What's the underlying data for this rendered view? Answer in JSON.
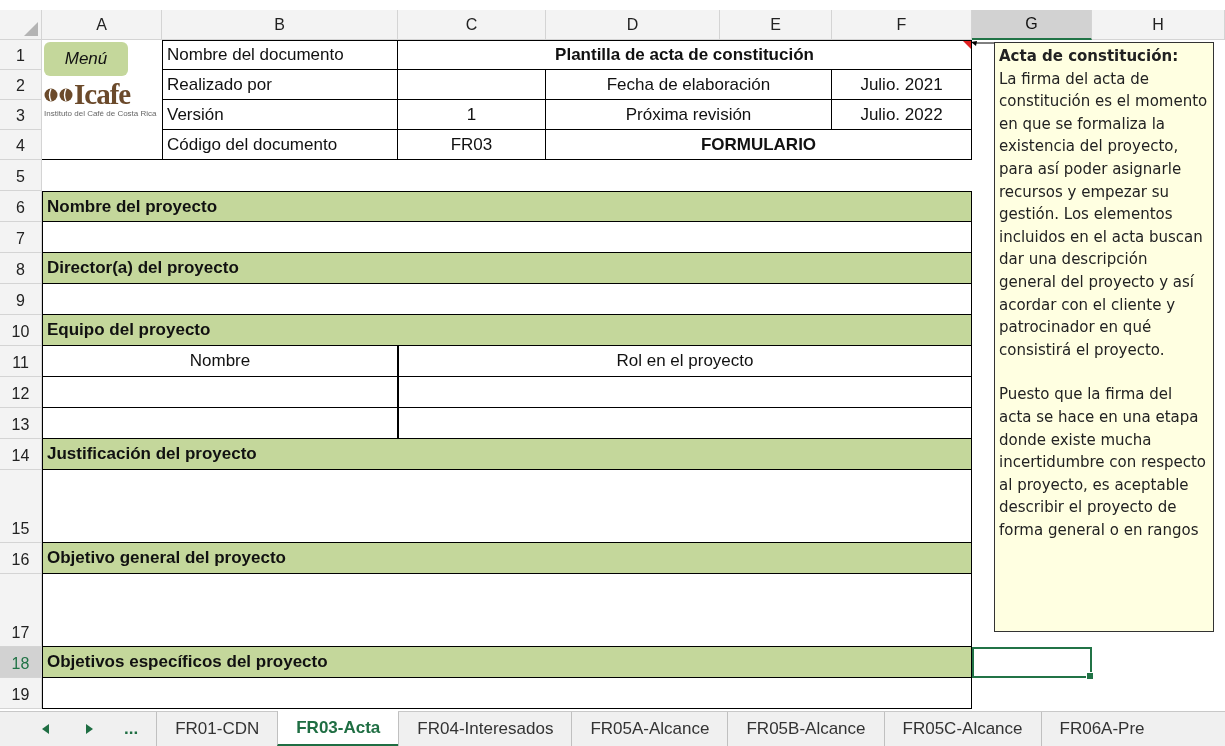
{
  "columns": [
    {
      "label": "A",
      "selected": false
    },
    {
      "label": "B",
      "selected": false
    },
    {
      "label": "C",
      "selected": false
    },
    {
      "label": "D",
      "selected": false
    },
    {
      "label": "E",
      "selected": false
    },
    {
      "label": "F",
      "selected": false
    },
    {
      "label": "G",
      "selected": true
    },
    {
      "label": "H",
      "selected": false
    }
  ],
  "row_numbers": [
    {
      "label": "1",
      "selected": false
    },
    {
      "label": "2",
      "selected": false
    },
    {
      "label": "3",
      "selected": false
    },
    {
      "label": "4",
      "selected": false
    },
    {
      "label": "5",
      "selected": false
    },
    {
      "label": "6",
      "selected": false
    },
    {
      "label": "7",
      "selected": false
    },
    {
      "label": "8",
      "selected": false
    },
    {
      "label": "9",
      "selected": false
    },
    {
      "label": "10",
      "selected": false
    },
    {
      "label": "11",
      "selected": false
    },
    {
      "label": "12",
      "selected": false
    },
    {
      "label": "13",
      "selected": false
    },
    {
      "label": "14",
      "selected": false
    },
    {
      "label": "15",
      "selected": false
    },
    {
      "label": "16",
      "selected": false
    },
    {
      "label": "17",
      "selected": false
    },
    {
      "label": "18",
      "selected": true
    },
    {
      "label": "19",
      "selected": false
    }
  ],
  "menu_button": "Menú",
  "logo": {
    "name": "Icafe",
    "subtitle": "Instituto del Café de Costa Rica"
  },
  "document_header": {
    "title_label": "Nombre del documento",
    "title": "Plantilla de acta de constitución",
    "author_label": "Realizado por",
    "date_label": "Fecha de elaboración",
    "date": "Julio. 2021",
    "version_label": "Versión",
    "version": "1",
    "revision_label": "Próxima revisión",
    "revision": "Julio. 2022",
    "code_label": "Código del documento",
    "code": "FR03",
    "form_type": "FORMULARIO"
  },
  "body_rows": [
    {
      "kind": "spacer"
    },
    {
      "kind": "heading",
      "text": "Nombre del proyecto"
    },
    {
      "kind": "blank"
    },
    {
      "kind": "heading",
      "text": "Director(a) del proyecto"
    },
    {
      "kind": "blank"
    },
    {
      "kind": "heading",
      "text": "Equipo del proyecto"
    },
    {
      "kind": "team-header",
      "cells": [
        "Nombre",
        "Rol en el proyecto"
      ]
    },
    {
      "kind": "team-row"
    },
    {
      "kind": "team-row"
    },
    {
      "kind": "heading",
      "text": "Justificación del proyecto"
    },
    {
      "kind": "blank-tall"
    },
    {
      "kind": "heading",
      "text": "Objetivo general del proyecto"
    },
    {
      "kind": "blank-tall"
    },
    {
      "kind": "heading",
      "text": "Objetivos específicos del proyecto"
    },
    {
      "kind": "blank"
    }
  ],
  "comment": {
    "title": "Acta de constitución:",
    "paragraphs": [
      "La firma del acta de constitución es el momento en que se formaliza la existencia del proyecto, para así poder asignarle recursos y empezar su gestión. Los elementos incluidos en el acta buscan dar una descripción general del proyecto y así acordar con el cliente y patrocinador en qué consistirá el proyecto.",
      "Puesto que la firma del acta se hace en una etapa donde existe mucha incertidumbre con respecto al proyecto, es aceptable describir el proyecto de forma general o en rangos"
    ]
  },
  "sheet_nav": {
    "more": "..."
  },
  "sheet_tabs": [
    {
      "label": "FR01-CDN",
      "selected": false
    },
    {
      "label": "FR03-Acta",
      "selected": true
    },
    {
      "label": "FR04-Interesados",
      "selected": false
    },
    {
      "label": "FR05A-Alcance",
      "selected": false
    },
    {
      "label": "FR05B-Alcance",
      "selected": false
    },
    {
      "label": "FR05C-Alcance",
      "selected": false
    },
    {
      "label": "FR06A-Pre",
      "selected": false
    }
  ]
}
